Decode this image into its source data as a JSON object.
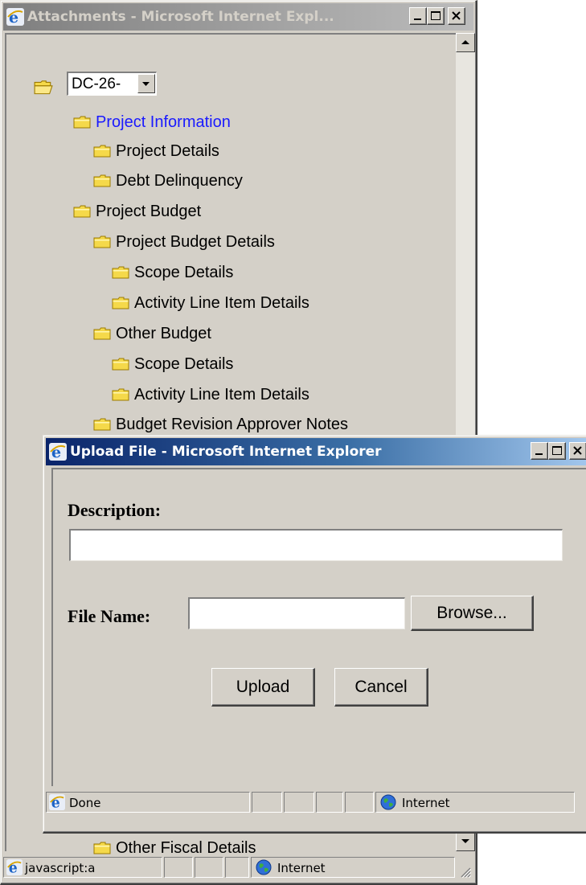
{
  "attachments_window": {
    "title": "Attachments - Microsoft Internet Expl...",
    "dropdown_value": "DC-26-",
    "tree": [
      {
        "label": "Project Information",
        "link": true
      },
      {
        "label": "Project Details"
      },
      {
        "label": "Debt Delinquency"
      },
      {
        "label": "Project Budget"
      },
      {
        "label": "Project Budget Details"
      },
      {
        "label": "Scope Details"
      },
      {
        "label": "Activity Line Item Details"
      },
      {
        "label": "Other Budget"
      },
      {
        "label": "Scope Details"
      },
      {
        "label": "Activity Line Item Details"
      },
      {
        "label": "Budget Revision Approver Notes"
      },
      {
        "label": "Other Fiscal Details"
      }
    ],
    "status": {
      "left": "javascript:a",
      "zone": "Internet"
    }
  },
  "upload_dialog": {
    "title": "Upload File - Microsoft Internet Explorer",
    "description_label": "Description:",
    "description_value": "",
    "file_name_label": "File Name:",
    "file_name_value": "",
    "browse_label": "Browse...",
    "upload_label": "Upload",
    "cancel_label": "Cancel",
    "status": {
      "left": "Done",
      "zone": "Internet"
    }
  },
  "colors": {
    "title_active": "#0a246a",
    "title_inactive": "#7f7f7f",
    "face": "#d4d0c8",
    "link": "#1a1aff"
  },
  "icons": [
    "ie-icon",
    "folder-open-icon",
    "folder-icon",
    "globe-icon",
    "minimize-icon",
    "maximize-icon",
    "close-icon",
    "scroll-up-icon",
    "scroll-down-icon",
    "dropdown-arrow-icon",
    "resize-grip-icon"
  ]
}
